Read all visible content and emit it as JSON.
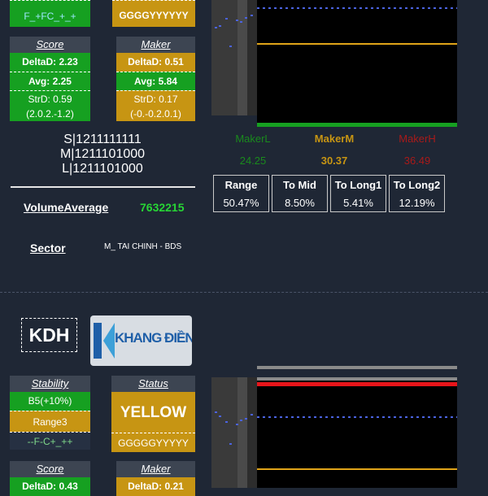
{
  "top": {
    "stability_trend": "F_+FC_+_+",
    "status_code": "GGGGYYYYYY",
    "score": {
      "header": "Score",
      "delta": "DeltaD: 2.23",
      "avg": "Avg: 2.25",
      "std": "StrD: 0.59",
      "range": "(2.0.2.-1.2)"
    },
    "maker": {
      "header": "Maker",
      "delta": "DeltaD: 0.51",
      "avg": "Avg: 5.84",
      "std": "StrD: 0.17",
      "range": "(-0.-0.2.0.1)"
    },
    "signals": {
      "s": "S|1211111111",
      "m": "M|1211101000",
      "l": "L|1211101000"
    },
    "volume_average": {
      "label": "VolumeAverage",
      "value": "7632215"
    },
    "sector": {
      "label": "Sector",
      "value": "M_ TAI CHINH - BDS"
    },
    "maker_levels": [
      {
        "label": "MakerL",
        "value": "24.25",
        "color": "#1a8a1d"
      },
      {
        "label": "MakerM",
        "value": "30.37",
        "color": "#c79513"
      },
      {
        "label": "MakerH",
        "value": "36.49",
        "color": "#a81a1a"
      }
    ],
    "ranges": {
      "headers": [
        "Range",
        "To Mid",
        "To Long1",
        "To Long2"
      ],
      "values": [
        "50.47%",
        "8.50%",
        "5.41%",
        "12.19%"
      ]
    }
  },
  "bottom": {
    "ticker": "KDH",
    "logo_text": "KHANG ĐIỀN",
    "stability": {
      "header": "Stability",
      "value": "B5(+10%)",
      "range": "Range3",
      "trend": "--F-C+_++"
    },
    "status": {
      "header": "Status",
      "value": "YELLOW",
      "code": "GGGGGYYYYY"
    },
    "score": {
      "header": "Score",
      "delta": "DeltaD: 0.43"
    },
    "maker": {
      "header": "Maker",
      "delta": "DeltaD: 0.21"
    }
  },
  "colors": {
    "green": "#16a021",
    "orange": "#c79513",
    "red": "#e8141a",
    "blue_dots": "#4b63e0",
    "chart_bg": "#000000"
  }
}
